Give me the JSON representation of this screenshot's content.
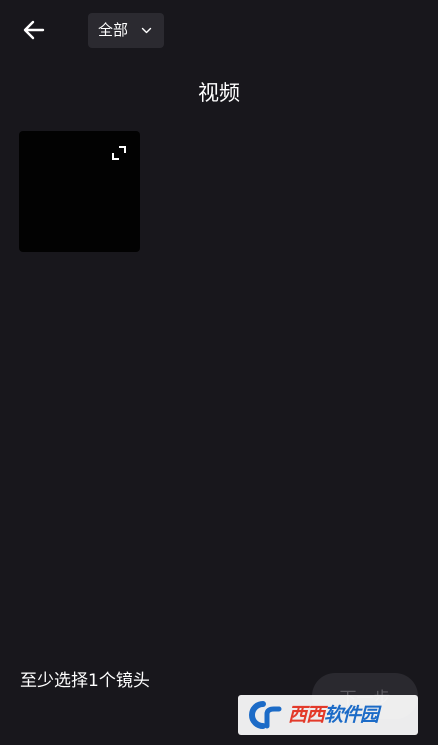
{
  "header": {
    "back_icon": "arrow-left-icon",
    "filter": {
      "selected": "全部",
      "icon": "chevron-down-icon"
    }
  },
  "page": {
    "title": "视频"
  },
  "media_grid": {
    "items": [
      {
        "type": "video",
        "background": "#020202",
        "expand_icon": "expand-icon"
      }
    ]
  },
  "footer": {
    "hint": "至少选择1个镜头",
    "next_button": "下一步"
  },
  "watermark": {
    "brand_red": "西西",
    "brand_blue": "软件园"
  },
  "colors": {
    "background": "#18171c",
    "dropdown_bg": "#2b2a30",
    "button_disabled_bg": "#2a292f",
    "button_disabled_text": "#5c5b61"
  }
}
